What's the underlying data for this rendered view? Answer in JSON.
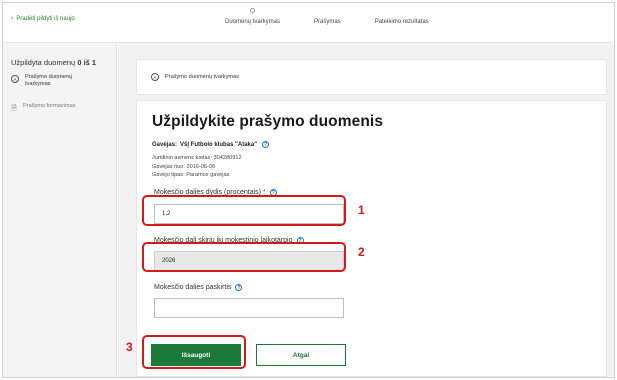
{
  "topbar": {
    "back_label": "Pradėti pildyti iš naujo",
    "steps": [
      {
        "label": "Duomenų tvarkymas"
      },
      {
        "label": "Prašymas"
      },
      {
        "label": "Pateikimo rezultatas"
      }
    ]
  },
  "sidebar": {
    "title_prefix": "Užpildyta duomenų",
    "progress": "0 iš 1",
    "items": [
      {
        "icon": "A",
        "label": "Prašymo duomenų tvarkymas"
      },
      {
        "icon": "doc",
        "label": "Prašymo formavimas"
      }
    ]
  },
  "section": {
    "icon": "A",
    "label": "Prašymo duomenų tvarkymas"
  },
  "form": {
    "title": "Užpildykite prašymo duomenis",
    "recipient_label": "Gavėjas:",
    "recipient_value": "VšĮ Futbolo klubas \"Ataka\"",
    "meta_code": "Juridinio asmens kodas: 304280912",
    "meta_since": "Gavėjas nuo: 2016-06-06",
    "meta_type": "Gavėjo tipas: Paramos gavėjas",
    "field1_label": "Mokesčio dalies dydis (procentais)",
    "field1_required": "*",
    "field1_value": "1,2",
    "field2_label": "Mokesčio dalį skirių iki mokestinio laikotarpio",
    "field2_value": "2026",
    "field3_label": "Mokesčio dalies paskirtis",
    "field3_value": "",
    "save_label": "Išsaugoti",
    "back_label": "Atgal",
    "help_glyph": "?"
  },
  "callouts": [
    {
      "number": "1"
    },
    {
      "number": "2"
    },
    {
      "number": "3"
    }
  ],
  "colors": {
    "primary": "#1b7a3a",
    "callout": "#d11a1a",
    "help": "#1f77c7",
    "required": "#d32f2f"
  }
}
